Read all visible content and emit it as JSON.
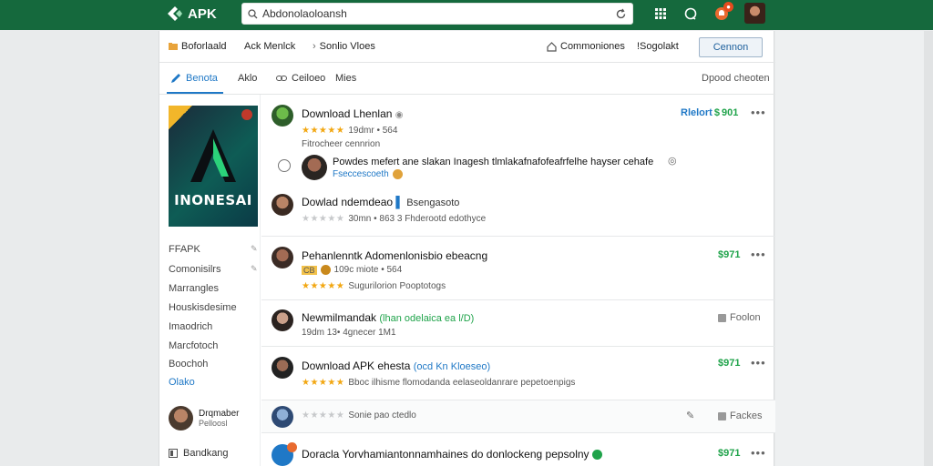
{
  "topbar": {
    "logo": "APK",
    "search_value": "Abdonolaoloansh"
  },
  "crumbs": {
    "c1": "Boforlaald",
    "c2": "Ack Menlck",
    "c3": "Sonlio Vloes",
    "c4": "Commoniones",
    "c5": "!Sogolakt",
    "button": "Cennon"
  },
  "tabs": {
    "t1": "Benota",
    "t2": "Aklo",
    "t3": "Ceiloeo",
    "t4": "Mies",
    "right": "Dpood cheoten"
  },
  "cover": {
    "title": "INONESAI"
  },
  "sidebar": {
    "items": [
      "FFAPK",
      "Comonisilrs",
      "Marrangles",
      "Houskisdesime",
      "Imaodrich",
      "Marcfotoch",
      "Boochoh",
      "Olako"
    ],
    "user_name": "Drqmaber",
    "user_sub": "Pelloosl",
    "bottom": "Bandkang"
  },
  "posts": [
    {
      "title": "Download Lhenlan",
      "meta": "19dmr • 564",
      "sub": "Fitrocheer cennrion",
      "price": "Rlelort",
      "price_val": "901",
      "reply_text": "Powdes mefert ane slakan Inagesh tlmlakafnafofeafrfelhe hayser cehafe",
      "reply_sub": "Fseccescoeth",
      "reply2_title": "Dowlad ndemdeao",
      "reply2_link": "Bsengasoto",
      "reply2_meta": "30mn • 863 3 Fhderootd edothyce"
    },
    {
      "title": "Pehanlenntk Adomenlonisbio ebeacng",
      "meta_tag": "CB",
      "meta": "109c miote • 564",
      "meta2": "Sugurilorion Pooptotogs",
      "price": "$971"
    },
    {
      "title": "Newmilmandak",
      "title_link": "(lhan odelaica ea l/D)",
      "meta": "19dm 13• 4gnecer 1M1",
      "action": "Foolon"
    },
    {
      "title": "Download APK ehesta",
      "title_link": "(ocd Kn Kloeseo)",
      "meta": "Bboc ilhisme flomodanda eelaseoldanrare pepetoenpigs",
      "price": "$971"
    },
    {
      "meta": "Sonie pao ctedlo",
      "action": "Fackes"
    },
    {
      "title": "Doracla Yorvhamiantonnamhaines do donlockeng pepsolny",
      "price": "$971"
    }
  ],
  "colors": {
    "topbar": "#15693d",
    "accent": "#1f78c6",
    "price": "#1fa34a",
    "star": "#f2a712"
  }
}
